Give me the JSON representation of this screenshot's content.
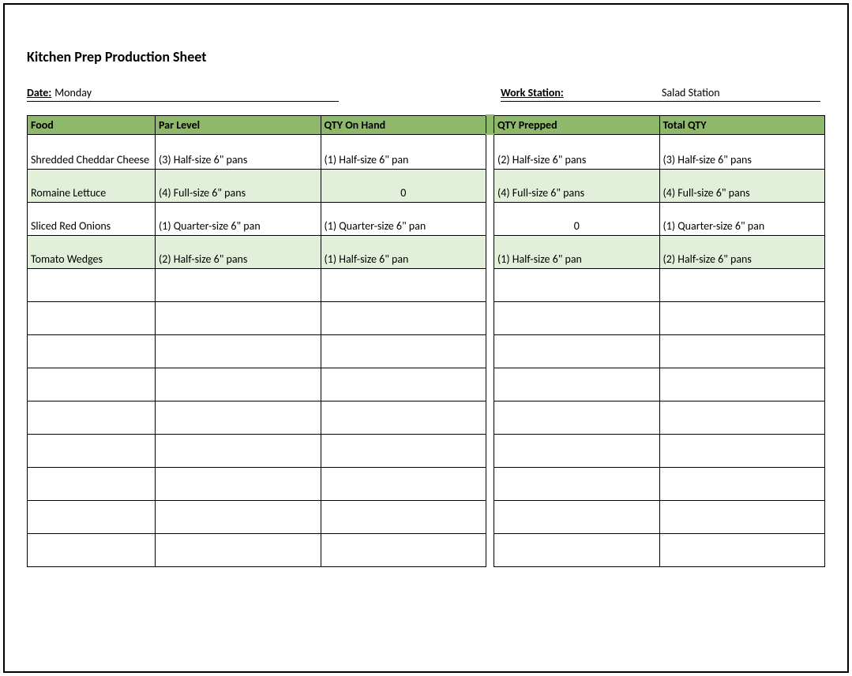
{
  "title": "Kitchen Prep Production Sheet",
  "meta": {
    "date_label": "Date:",
    "date_value": " Monday",
    "station_label": "Work Station:",
    "station_value": "Salad Station"
  },
  "columns": {
    "food": "Food",
    "par": "Par Level",
    "onhand": "QTY On Hand",
    "prepped": "QTY Prepped",
    "total": "Total QTY"
  },
  "rows": [
    {
      "food": "Shredded Cheddar Cheese",
      "par": "(3) Half-size 6\" pans",
      "onhand": "(1) Half-size 6\" pan",
      "prepped": "(2) Half-size 6\" pans",
      "total": "(3) Half-size 6\" pans",
      "alt": false,
      "onhand_center": false,
      "prepped_center": false
    },
    {
      "food": "Romaine Lettuce",
      "par": "(4) Full-size 6\" pans",
      "onhand": "0",
      "prepped": "(4) Full-size 6\" pans",
      "total": "(4) Full-size 6\" pans",
      "alt": true,
      "onhand_center": true,
      "prepped_center": false
    },
    {
      "food": "Sliced Red Onions",
      "par": "(1) Quarter-size 6\" pan",
      "onhand": "(1) Quarter-size 6\" pan",
      "prepped": "0",
      "total": "(1) Quarter-size 6\" pan",
      "alt": false,
      "onhand_center": false,
      "prepped_center": true
    },
    {
      "food": "Tomato Wedges",
      "par": "(2) Half-size 6\" pans",
      "onhand": "(1) Half-size 6\" pan",
      "prepped": "(1) Half-size 6\" pan",
      "total": "(2) Half-size 6\" pans",
      "alt": true,
      "onhand_center": false,
      "prepped_center": false
    }
  ],
  "empty_row_count": 9
}
